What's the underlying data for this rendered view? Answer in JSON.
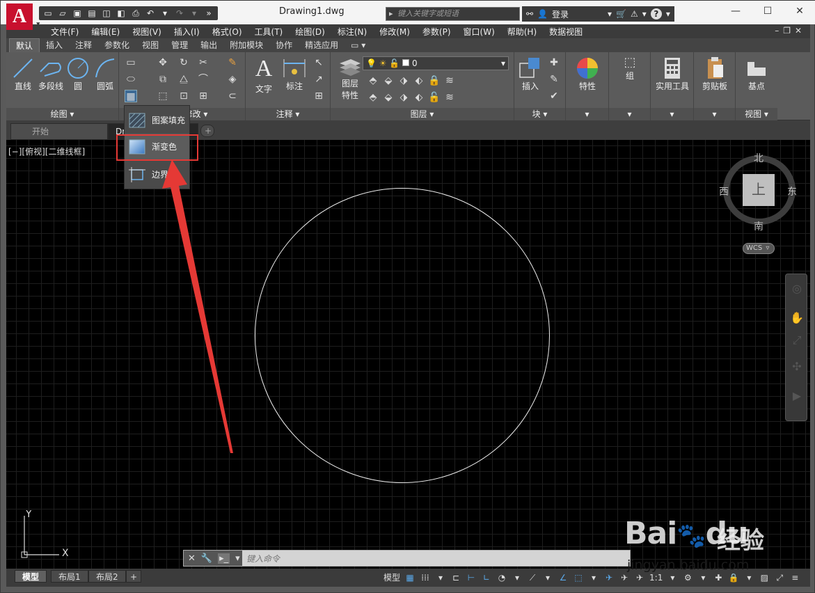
{
  "app": {
    "logo_letter": "A",
    "document_title": "Drawing1.dwg",
    "search_placeholder": "键入关键字或短语",
    "login_label": "登录",
    "help_label": "?"
  },
  "menu": [
    "文件(F)",
    "编辑(E)",
    "视图(V)",
    "插入(I)",
    "格式(O)",
    "工具(T)",
    "绘图(D)",
    "标注(N)",
    "修改(M)",
    "参数(P)",
    "窗口(W)",
    "帮助(H)",
    "数据视图"
  ],
  "ribbon_tabs": [
    "默认",
    "插入",
    "注释",
    "参数化",
    "视图",
    "管理",
    "输出",
    "附加模块",
    "协作",
    "精选应用"
  ],
  "ribbon": {
    "draw": {
      "line": "直线",
      "polyline": "多段线",
      "circle": "圆",
      "arc": "圆弧",
      "title": "绘图 ▾"
    },
    "modify": {
      "title": "修改 ▾"
    },
    "annotation": {
      "text": "文字",
      "dimension": "标注",
      "title": "注释 ▾"
    },
    "layers": {
      "layer_props": "图层",
      "layer_props2": "特性",
      "current_layer": "0",
      "title": "图层 ▾"
    },
    "block": {
      "insert": "插入",
      "title": "块 ▾"
    },
    "properties": {
      "label": "特性"
    },
    "groups": {
      "label": "组"
    },
    "utilities": {
      "label": "实用工具"
    },
    "clipboard": {
      "label": "剪贴板"
    },
    "view": {
      "base": "基点",
      "title": "视图 ▾"
    }
  },
  "file_tabs": {
    "start": "开始",
    "drawing": "Dr",
    "add": "+"
  },
  "viewport_label": "[−][俯视][二维线框]",
  "dropdown": {
    "items": [
      "图案填充",
      "渐变色",
      "边界"
    ],
    "highlighted": "渐变色"
  },
  "viewcube": {
    "north": "北",
    "south": "南",
    "east": "东",
    "west": "西",
    "face": "上",
    "wcs": "WCS"
  },
  "ucs": {
    "x": "X",
    "y": "Y"
  },
  "command_line": {
    "placeholder": "键入命令"
  },
  "layout_tabs": [
    "模型",
    "布局1",
    "布局2",
    "+"
  ],
  "status_bar": {
    "model": "模型",
    "scale": "1:1"
  },
  "watermark": {
    "brand": "Bai",
    "brand2": "du",
    "suffix": "经验",
    "url": "jingyan.baidu.com"
  },
  "colors": {
    "annotation_red": "#e53935",
    "canvas": "#000000",
    "ribbon": "#5b5b5b",
    "logo": "#c8102e"
  }
}
